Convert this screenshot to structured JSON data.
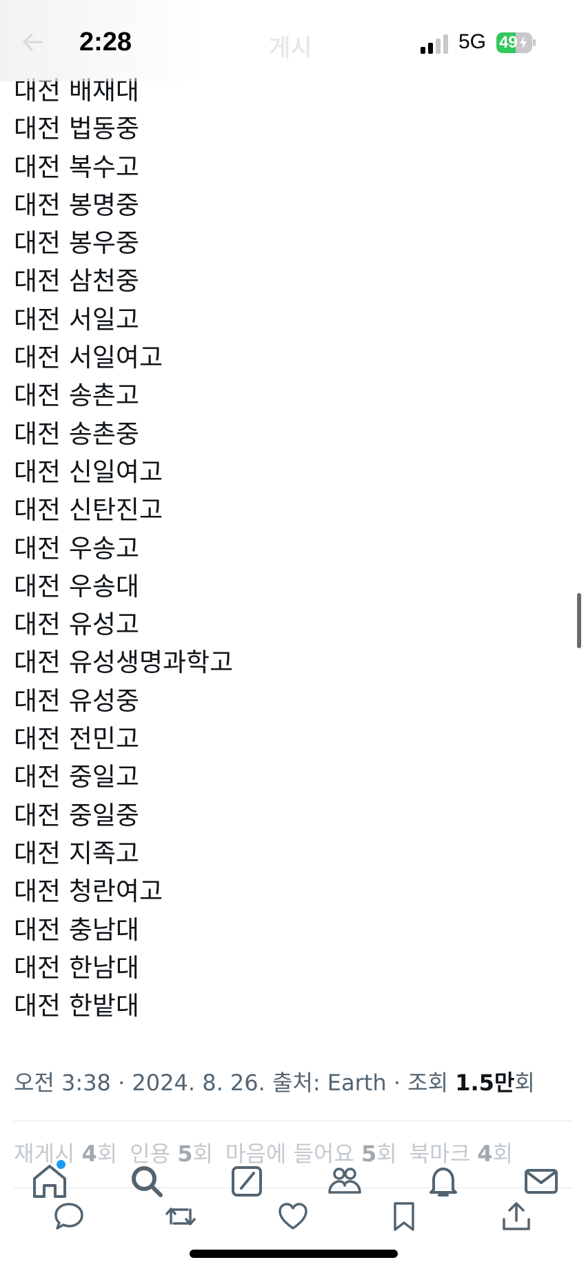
{
  "status_bar": {
    "time": "2:28",
    "network": "5G",
    "battery_level": "49",
    "battery_color": "#34c759"
  },
  "header": {
    "title": "게시"
  },
  "schools": [
    "대전 배재대",
    "대전 법동중",
    "대전 복수고",
    "대전 봉명중",
    "대전 봉우중",
    "대전 삼천중",
    "대전 서일고",
    "대전 서일여고",
    "대전 송촌고",
    "대전 송촌중",
    "대전 신일여고",
    "대전 신탄진고",
    "대전 우송고",
    "대전 우송대",
    "대전 유성고",
    "대전 유성생명과학고",
    "대전 유성중",
    "대전 전민고",
    "대전 중일고",
    "대전 중일중",
    "대전 지족고",
    "대전 청란여고",
    "대전 충남대",
    "대전 한남대",
    "대전 한밭대"
  ],
  "meta": {
    "prefix": "오전 3:38 · 2024. 8. 26. 출처: Earth · 조회 ",
    "views": "1.5만",
    "suffix": "회"
  },
  "stats": [
    {
      "label": "재게시",
      "count": "4",
      "unit": "회"
    },
    {
      "label": "인용",
      "count": "5",
      "unit": "회"
    },
    {
      "label": "마음에 들어요",
      "count": "5",
      "unit": "회"
    },
    {
      "label": "북마크",
      "count": "4",
      "unit": "회"
    }
  ],
  "tab_bar": {
    "items": [
      "home-icon",
      "search-icon",
      "compose-icon",
      "communities-icon",
      "notifications-icon",
      "messages-icon"
    ],
    "active_dot_color": "#1d9bf0"
  },
  "action_bar": {
    "items": [
      "reply-icon",
      "retweet-icon",
      "like-icon",
      "bookmark-icon",
      "share-icon"
    ]
  }
}
